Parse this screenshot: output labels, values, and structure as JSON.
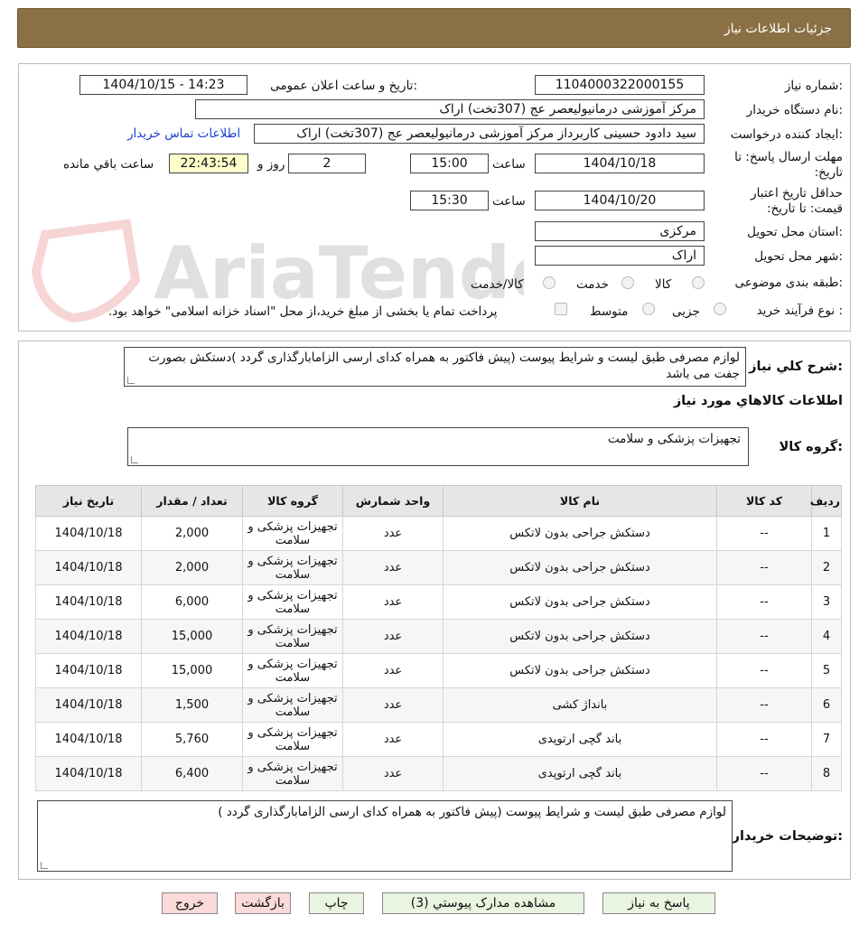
{
  "header": {
    "title": "جزئیات اطلاعات نیاز"
  },
  "watermark": "AriaTender.neT",
  "form": {
    "need_number_label": "شماره نیاز:",
    "need_number": "1104000322000155",
    "announce_label": "تاریخ و ساعت اعلان عمومی:",
    "announce_value": "1404/10/15 - 14:23",
    "buyer_org_label": "نام دستگاه خریدار:",
    "buyer_org": "مرکز آموزشی درمانیولیعصر عج (307تخت) اراک",
    "creator_label": "ایجاد کننده درخواست:",
    "creator": "سید دادود حسینی کاربرداز مرکز آموزشی درمانیولیعصر عج (307تخت) اراک",
    "contact_link": "اطلاعات تماس خریدار",
    "deadline_label": "مهلت ارسال پاسخ: تا تاریخ:",
    "deadline_date": "1404/10/18",
    "time_label": "ساعت",
    "deadline_time": "15:00",
    "days_value": "2",
    "days_label": "روز و",
    "remaining_time": "22:43:54",
    "remaining_label": "ساعت باقي مانده",
    "validity_label": "حداقل تاریخ اعتبار قیمت: تا تاریخ:",
    "validity_date": "1404/10/20",
    "validity_time": "15:30",
    "province_label": "استان محل تحویل:",
    "province": "مرکزی",
    "city_label": "شهر محل تحویل:",
    "city": "اراک",
    "category_label": "طبقه بندی موضوعی:",
    "category_options": [
      "کالا",
      "خدمت",
      "کالا/خدمت"
    ],
    "purchase_type_label": "نوع فرآیند خرید :",
    "purchase_options": [
      "جزیی",
      "متوسط"
    ],
    "payment_note": "پرداخت تمام یا بخشی از مبلغ خرید،از محل \"اسناد خزانه اسلامی\" خواهد بود."
  },
  "description": {
    "label": "شرح كلي نياز:",
    "text": "لوازم مصرفی طبق لیست و شرایط پیوست (پیش فاکتور به همراه کدای ارسی الزامابارگذاری گردد )دستکش بصورت جفت می باشد"
  },
  "goods": {
    "section_title": "اطلاعات كالاهاي مورد نياز",
    "group_label": "گروه کالا:",
    "group_value": "تجهیزات پزشکی و سلامت"
  },
  "table": {
    "headers": [
      "ردیف",
      "کد کالا",
      "نام کالا",
      "واحد شمارش",
      "گروه کالا",
      "تعداد / مقدار",
      "تاریخ نیاز"
    ],
    "rows": [
      {
        "idx": "1",
        "code": "--",
        "name": "دستکش جراحی بدون لاتکس",
        "unit": "عدد",
        "group": "تجهیزات پزشکی و سلامت",
        "qty": "2,000",
        "date": "1404/10/18"
      },
      {
        "idx": "2",
        "code": "--",
        "name": "دستکش جراحی بدون لاتکس",
        "unit": "عدد",
        "group": "تجهیزات پزشکی و سلامت",
        "qty": "2,000",
        "date": "1404/10/18"
      },
      {
        "idx": "3",
        "code": "--",
        "name": "دستکش جراحی بدون لاتکس",
        "unit": "عدد",
        "group": "تجهیزات پزشکی و سلامت",
        "qty": "6,000",
        "date": "1404/10/18"
      },
      {
        "idx": "4",
        "code": "--",
        "name": "دستکش جراحی بدون لاتکس",
        "unit": "عدد",
        "group": "تجهیزات پزشکی و سلامت",
        "qty": "15,000",
        "date": "1404/10/18"
      },
      {
        "idx": "5",
        "code": "--",
        "name": "دستکش جراحی بدون لاتکس",
        "unit": "عدد",
        "group": "تجهیزات پزشکی و سلامت",
        "qty": "15,000",
        "date": "1404/10/18"
      },
      {
        "idx": "6",
        "code": "--",
        "name": "بانداژ کشی",
        "unit": "عدد",
        "group": "تجهیزات پزشکی و سلامت",
        "qty": "1,500",
        "date": "1404/10/18"
      },
      {
        "idx": "7",
        "code": "--",
        "name": "باند گچی ارتوپدی",
        "unit": "عدد",
        "group": "تجهیزات پزشکی و سلامت",
        "qty": "5,760",
        "date": "1404/10/18"
      },
      {
        "idx": "8",
        "code": "--",
        "name": "باند گچی ارتوپدی",
        "unit": "عدد",
        "group": "تجهیزات پزشکی و سلامت",
        "qty": "6,400",
        "date": "1404/10/18"
      }
    ]
  },
  "buyer_notes": {
    "label": "توضیحات خریدار:",
    "text": "لوازم مصرفی طبق لیست و شرایط پیوست (پیش فاکتور به همراه کدای ارسی الزامابارگذاری گردد )"
  },
  "buttons": {
    "reply": "پاسخ به نیاز",
    "attachments": "مشاهده مدارک پیوستي (3)",
    "print": "چاپ",
    "back": "بازگشت",
    "exit": "خروج"
  }
}
